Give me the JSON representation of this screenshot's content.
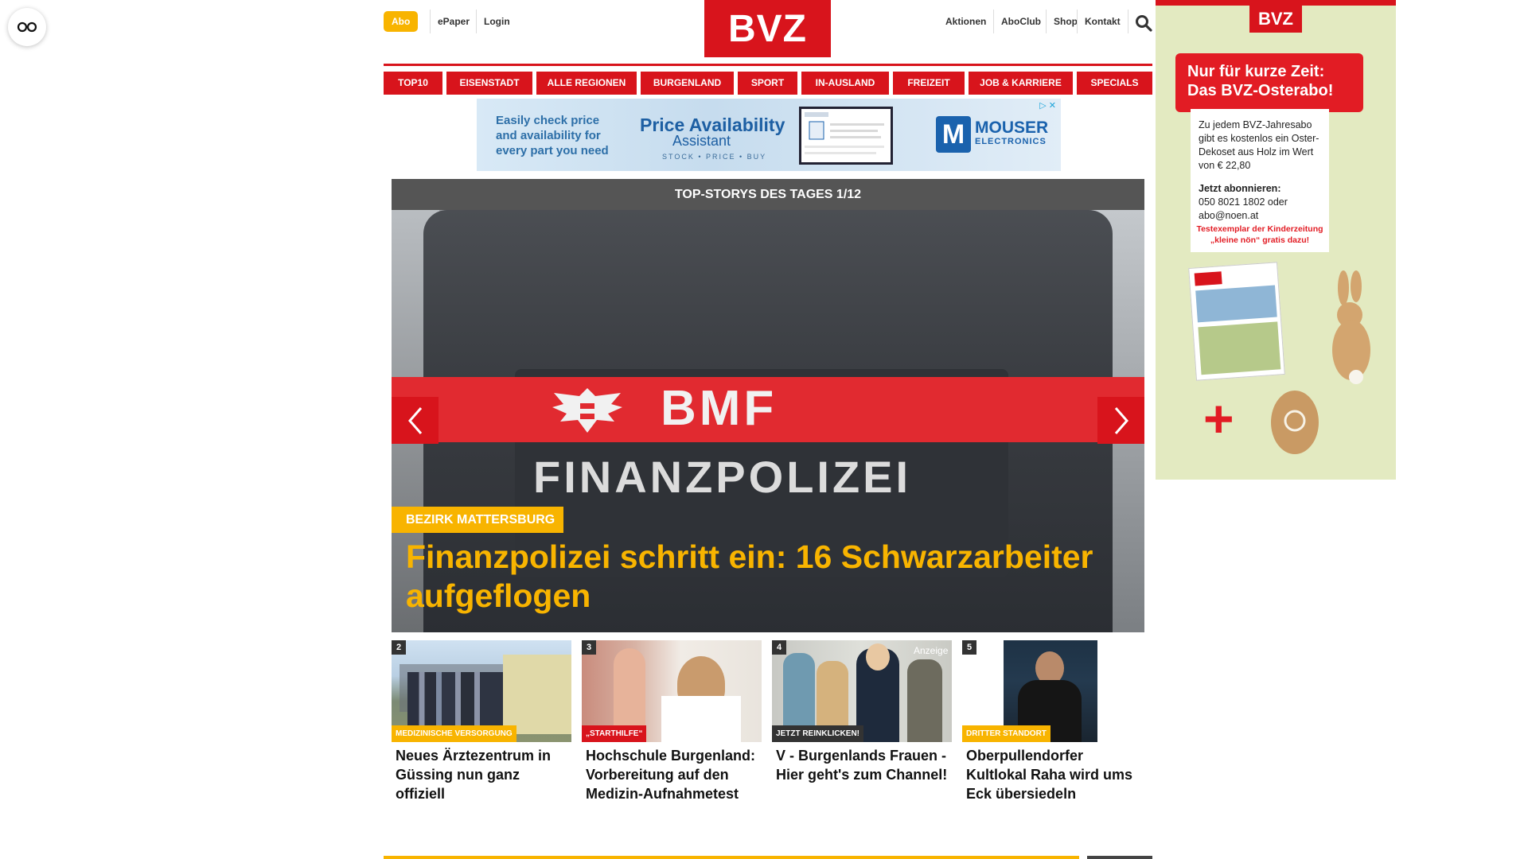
{
  "header": {
    "abo": "Abo",
    "links_left": [
      "ePaper",
      "Login"
    ],
    "logo": "BVZ",
    "links_right": [
      "Aktionen",
      "AboClub",
      "Shop",
      "Kontakt"
    ]
  },
  "nav": [
    "TOP10",
    "EISENSTADT",
    "ALLE REGIONEN",
    "BURGENLAND",
    "SPORT",
    "IN-AUSLAND",
    "FREIZEIT",
    "JOB & KARRIERE",
    "SPECIALS"
  ],
  "ad_top": {
    "text": "Easily check price and availability for every part you need",
    "title": "Price Availability",
    "subtitle": "Assistant",
    "tagline": "STOCK • PRICE • BUY",
    "brand_letter": "M",
    "brand": "MOUSER",
    "brand_sub": "ELECTRONICS"
  },
  "stories": {
    "header": "TOP-STORYS DES TAGES 1/12",
    "hero_image": {
      "patch_top": "BMF",
      "patch_bottom": "FINANZPOLIZEI"
    },
    "hero": {
      "category": "BEZIRK MATTERSBURG",
      "title": "Finanzpolizei schritt ein: 16 Schwarzarbeiter aufgeflogen"
    },
    "teasers": [
      {
        "num": "2",
        "category": "MEDIZINISCHE VERSORGUNG",
        "title": "Neues Ärztezentrum in Güssing nun ganz offiziell"
      },
      {
        "num": "3",
        "category": "„STARTHILFE“",
        "title": "Hochschule Burgenland: Vorbereitung auf den Medizin-Aufnahmetest"
      },
      {
        "num": "4",
        "category": "JETZT REINKLICKEN!",
        "title": "V - Burgenlands Frauen - Hier geht's zum Channel!",
        "badge": "Anzeige"
      },
      {
        "num": "5",
        "category": "DRITTER STANDORT",
        "title": "Oberpullendorfer Kultlokal Raha wird ums Eck übersiedeln"
      }
    ]
  },
  "side_ad": {
    "logo": "BVZ",
    "headline_1": "Nur für kurze Zeit:",
    "headline_2": "Das BVZ-Osterabo!",
    "body": "Zu jedem BVZ-Jahresabo gibt es kostenlos ein Oster-Dekoset aus Holz im Wert von € 22,80",
    "cta_title": "Jetzt abonnieren:",
    "cta_body": "050 8021 1802 oder abo@noen.at",
    "kinder_1": "Testexemplar der Kinderzeitung",
    "kinder_2": "„kleine nön“ gratis dazu!",
    "plus": "+"
  },
  "colors": {
    "brand_red": "#d8141c",
    "accent_yellow": "#f8b400"
  }
}
